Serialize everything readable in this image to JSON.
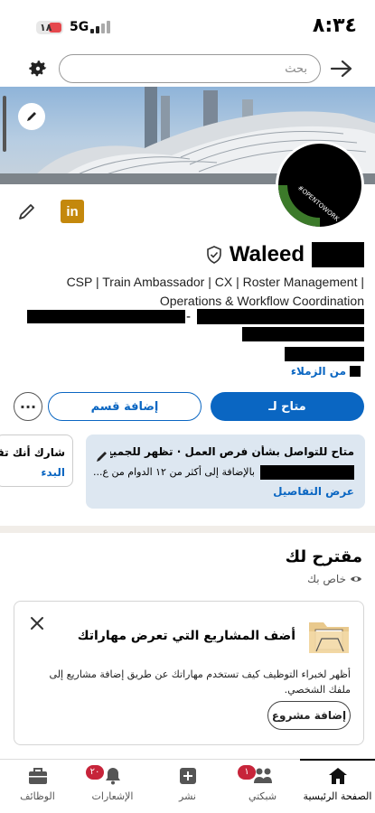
{
  "status_bar": {
    "time": "٨:٣٤",
    "battery_level": "١٨",
    "network": "5G"
  },
  "search": {
    "placeholder": "بحث"
  },
  "profile": {
    "name": "Waleed",
    "headline": "CSP | Train Ambassador | CX | Roster Management | Operations & Workflow Coordination",
    "colleagues_label": "من الزملاء",
    "open_to_work_ring": "#OPENTOWORK"
  },
  "actions": {
    "primary": "متاح لـ",
    "secondary": "إضافة قسم",
    "more": "···"
  },
  "open_to_work_card": {
    "title": "متاح للتواصل بشأن فرص العمل · تظهر للجميع ع...",
    "details": "بالإضافة إلى أكثر من ١٢ الدوام من ع...",
    "link": "عرض التفاصيل"
  },
  "share_card": {
    "title": "شارك أنك تقو",
    "link": "البدء"
  },
  "suggested": {
    "title": "مقترح لك",
    "subtitle": "خاص بك"
  },
  "project_card": {
    "title": "أضف المشاريع التي تعرض مهاراتك",
    "description": "أظهر لخبراء التوظيف كيف تستخدم مهاراتك عن طريق إضافة مشاريع إلى ملفك الشخصي.",
    "button": "إضافة مشروع"
  },
  "bottom_nav": [
    {
      "label": "الوظائف",
      "icon": "briefcase-icon"
    },
    {
      "label": "الإشعارات",
      "icon": "bell-icon",
      "badge": "٢٠"
    },
    {
      "label": "نشر",
      "icon": "plus-square-icon"
    },
    {
      "label": "شبكتي",
      "icon": "people-icon",
      "badge": "١"
    },
    {
      "label": "الصفحة الرئيسية",
      "icon": "home-icon",
      "active": true
    }
  ],
  "colors": {
    "accent": "#0a66c2",
    "open_card_bg": "#dde7f1",
    "badge": "#c7243a",
    "open_to_work_green": "#3c7a2a"
  }
}
